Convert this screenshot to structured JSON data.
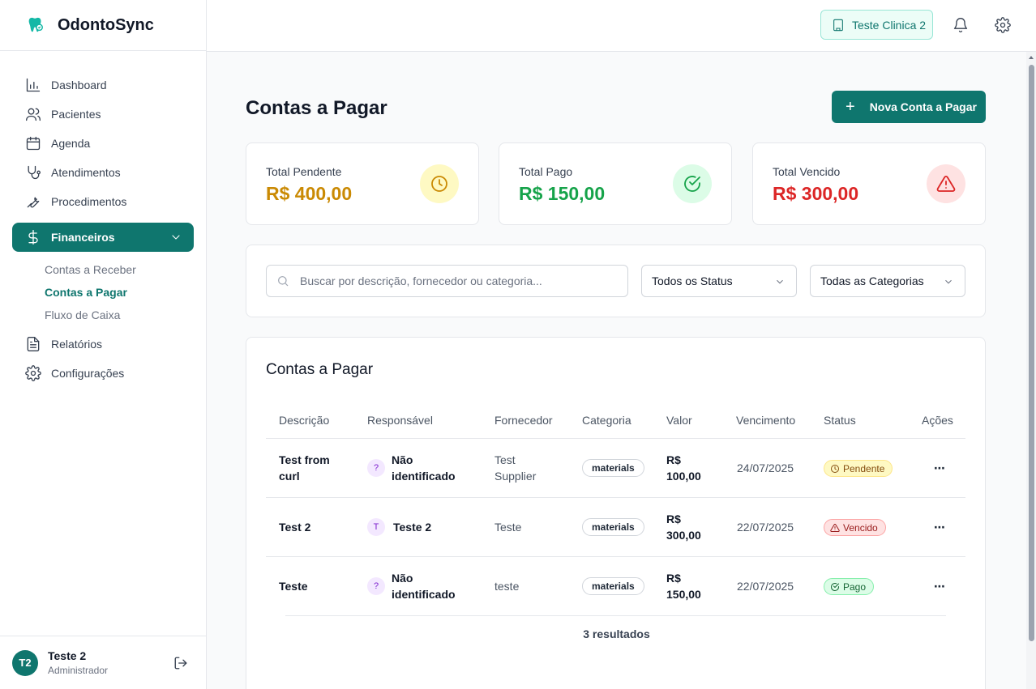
{
  "app": {
    "name": "OdontoSync"
  },
  "header": {
    "clinic_label": "Teste Clinica 2"
  },
  "sidebar": {
    "items": [
      {
        "label": "Dashboard"
      },
      {
        "label": "Pacientes"
      },
      {
        "label": "Agenda"
      },
      {
        "label": "Atendimentos"
      },
      {
        "label": "Procedimentos"
      },
      {
        "label": "Financeiros"
      },
      {
        "label": "Relatórios"
      },
      {
        "label": "Configurações"
      }
    ],
    "financeiros_sub": [
      {
        "label": "Contas a Receber"
      },
      {
        "label": "Contas a Pagar"
      },
      {
        "label": "Fluxo de Caixa"
      }
    ]
  },
  "user": {
    "initials": "T2",
    "name": "Teste 2",
    "role": "Administrador"
  },
  "page": {
    "title": "Contas a Pagar",
    "new_button": "Nova Conta a Pagar"
  },
  "stats": [
    {
      "label": "Total Pendente",
      "value": "R$ 400,00",
      "color": "#ca8a04",
      "icon": "clock-icon"
    },
    {
      "label": "Total Pago",
      "value": "R$ 150,00",
      "color": "#16a34a",
      "icon": "check-circle-icon"
    },
    {
      "label": "Total Vencido",
      "value": "R$ 300,00",
      "color": "#dc2626",
      "icon": "alert-triangle-icon"
    }
  ],
  "filters": {
    "search_placeholder": "Buscar por descrição, fornecedor ou categoria...",
    "status_value": "Todos os Status",
    "category_value": "Todas as Categorias"
  },
  "table": {
    "title": "Contas a Pagar",
    "columns": [
      "Descrição",
      "Responsável",
      "Fornecedor",
      "Categoria",
      "Valor",
      "Vencimento",
      "Status",
      "Ações"
    ],
    "rows": [
      {
        "descricao": [
          "Test from",
          "curl"
        ],
        "resp_initial": "?",
        "responsavel": [
          "Não",
          "identificado"
        ],
        "fornecedor": [
          "Test",
          "Supplier"
        ],
        "categoria": "materials",
        "valor": [
          "R$",
          "100,00"
        ],
        "vencimento": "24/07/2025",
        "status": "Pendente"
      },
      {
        "descricao": [
          "Test 2"
        ],
        "resp_initial": "T",
        "responsavel": [
          "Teste 2"
        ],
        "fornecedor": [
          "Teste"
        ],
        "categoria": "materials",
        "valor": [
          "R$",
          "300,00"
        ],
        "vencimento": "22/07/2025",
        "status": "Vencido"
      },
      {
        "descricao": [
          "Teste"
        ],
        "resp_initial": "?",
        "responsavel": [
          "Não",
          "identificado"
        ],
        "fornecedor": [
          "teste"
        ],
        "categoria": "materials",
        "valor": [
          "R$",
          "150,00"
        ],
        "vencimento": "22/07/2025",
        "status": "Pago"
      }
    ],
    "results_text": "3 resultados"
  }
}
